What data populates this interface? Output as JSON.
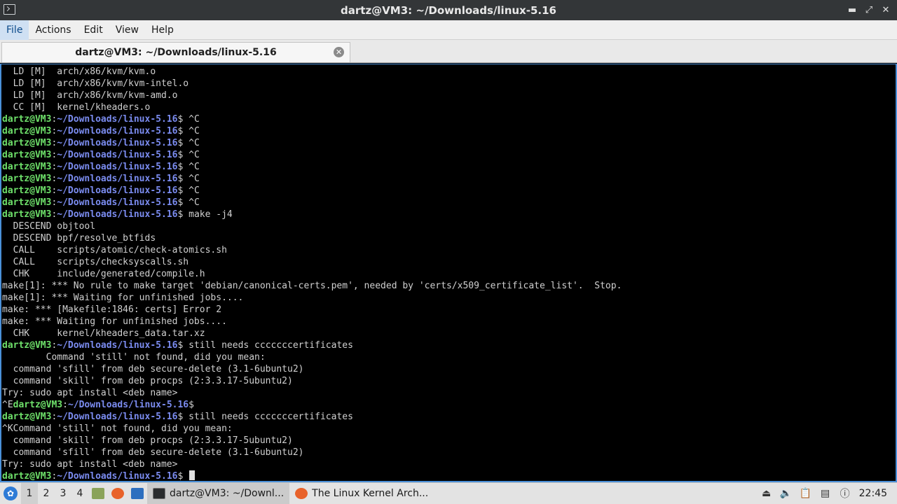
{
  "window": {
    "title": "dartz@VM3: ~/Downloads/linux-5.16"
  },
  "menu": {
    "items": [
      "File",
      "Actions",
      "Edit",
      "View",
      "Help"
    ]
  },
  "tab": {
    "label": "dartz@VM3: ~/Downloads/linux-5.16"
  },
  "prompt": {
    "user": "dartz@VM3",
    "path": "~/Downloads/linux-5.16"
  },
  "terminal": {
    "lines": [
      {
        "t": "  LD [M]  arch/x86/kvm/kvm.o"
      },
      {
        "t": "  LD [M]  arch/x86/kvm/kvm-intel.o"
      },
      {
        "t": "  LD [M]  arch/x86/kvm/kvm-amd.o"
      },
      {
        "t": "  CC [M]  kernel/kheaders.o"
      },
      {
        "p": true,
        "cmd": "^C"
      },
      {
        "p": true,
        "cmd": "^C"
      },
      {
        "p": true,
        "cmd": "^C"
      },
      {
        "p": true,
        "cmd": "^C"
      },
      {
        "p": true,
        "cmd": "^C"
      },
      {
        "p": true,
        "cmd": "^C"
      },
      {
        "p": true,
        "cmd": "^C"
      },
      {
        "p": true,
        "cmd": "^C"
      },
      {
        "p": true,
        "cmd": "make -j4"
      },
      {
        "t": "  DESCEND objtool"
      },
      {
        "t": "  DESCEND bpf/resolve_btfids"
      },
      {
        "t": "  CALL    scripts/atomic/check-atomics.sh"
      },
      {
        "t": "  CALL    scripts/checksyscalls.sh"
      },
      {
        "t": "  CHK     include/generated/compile.h"
      },
      {
        "t": "make[1]: *** No rule to make target 'debian/canonical-certs.pem', needed by 'certs/x509_certificate_list'.  Stop."
      },
      {
        "t": "make[1]: *** Waiting for unfinished jobs...."
      },
      {
        "t": "make: *** [Makefile:1846: certs] Error 2"
      },
      {
        "t": "make: *** Waiting for unfinished jobs...."
      },
      {
        "t": "  CHK     kernel/kheaders_data.tar.xz"
      },
      {
        "p": true,
        "cmd": "still needs cccccccertificates"
      },
      {
        "t": "        Command 'still' not found, did you mean:"
      },
      {
        "t": "  command 'sfill' from deb secure-delete (3.1-6ubuntu2)"
      },
      {
        "t": "  command 'skill' from deb procps (2:3.3.17-5ubuntu2)"
      },
      {
        "t": "Try: sudo apt install <deb name>"
      },
      {
        "p": true,
        "pre": "^E",
        "cmd": ""
      },
      {
        "p": true,
        "cmd": "still needs cccccccertificates"
      },
      {
        "t": "^KCommand 'still' not found, did you mean:"
      },
      {
        "t": "  command 'skill' from deb procps (2:3.3.17-5ubuntu2)"
      },
      {
        "t": "  command 'sfill' from deb secure-delete (3.1-6ubuntu2)"
      },
      {
        "t": "Try: sudo apt install <deb name>"
      },
      {
        "p": true,
        "cmd": "",
        "cursor": true
      }
    ]
  },
  "taskbar": {
    "workspaces": [
      "1",
      "2",
      "3",
      "4"
    ],
    "tasks": [
      {
        "label": "dartz@VM3: ~/Downl...",
        "icon": "terminal-icon"
      },
      {
        "label": "The Linux Kernel Arch...",
        "icon": "firefox-icon"
      }
    ],
    "clock": "22:45",
    "colors": {
      "firefox": "#e8622a",
      "filemanager": "#8aa35a",
      "desktop": "#2d6fbf",
      "start": "#2d7bd6"
    }
  }
}
